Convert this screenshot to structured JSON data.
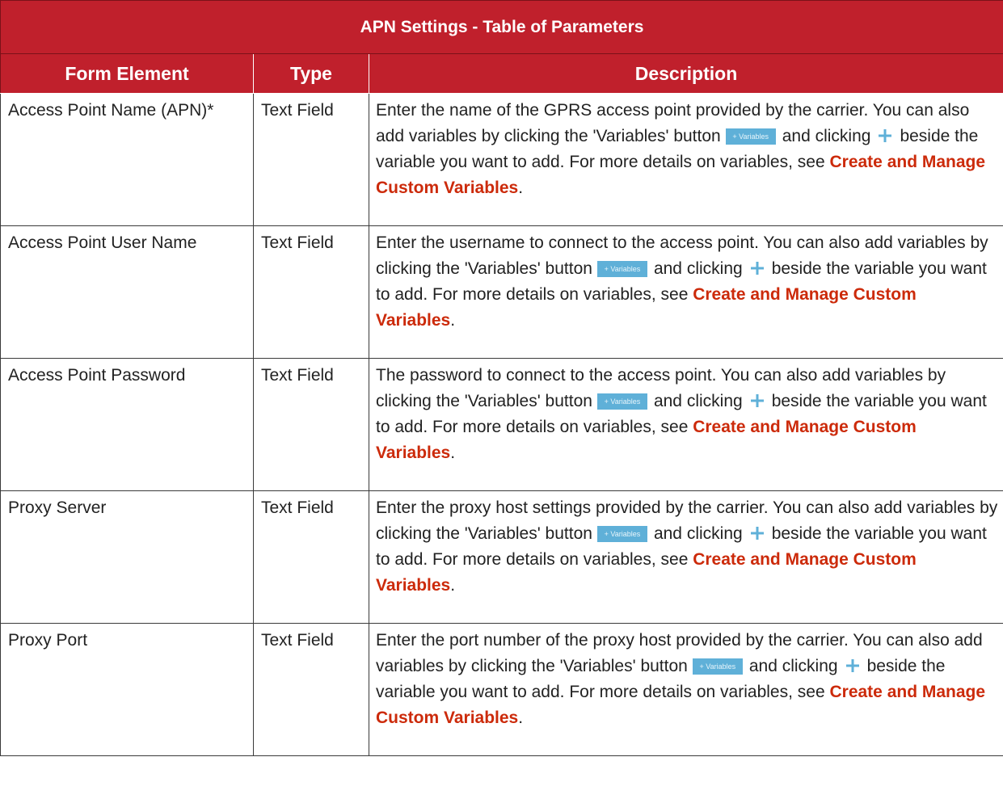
{
  "table": {
    "title": "APN Settings - Table of Parameters",
    "headers": [
      "Form Element",
      "Type",
      "Description"
    ],
    "variables_button_label": "+ Variables",
    "link_text": "Create and Manage Custom Variables",
    "rows": [
      {
        "element": "Access Point Name (APN)*",
        "type": "Text Field",
        "desc_a": "Enter the name of the GPRS access point provided by the carrier. You can also add variables by clicking the 'Variables' button",
        "desc_b": "and clicking",
        "desc_c": "beside the variable you want to add.  For more details on variables, see",
        "desc_end": "."
      },
      {
        "element": "Access Point User Name",
        "type": "Text Field",
        "desc_a": "Enter the username to connect to the access point. You can also add variables by clicking the 'Variables' button",
        "desc_b": "and clicking",
        "desc_c": "beside the variable you want to add. For more details on variables, see",
        "desc_end": "."
      },
      {
        "element": "Access Point Password",
        "type": "Text Field",
        "desc_a": "The password to connect to the access point. You can also add variables by clicking the 'Variables' button",
        "desc_b": "and clicking",
        "desc_c": "beside the variable you want to add. For more details on variables, see",
        "desc_end": "."
      },
      {
        "element": "Proxy Server",
        "type": "Text Field",
        "desc_a": "Enter the proxy host settings provided by the carrier. You can also add variables by clicking the 'Variables' button",
        "desc_b": "and clicking",
        "desc_c": "beside the variable you want to add. For more details on variables, see",
        "desc_end": "."
      },
      {
        "element": "Proxy Port",
        "type": "Text Field",
        "desc_a": "Enter the port number of the proxy host provided by the carrier. You can also add variables by clicking the 'Variables' button",
        "desc_b": "and clicking",
        "desc_c": "beside the variable you want to add. For more details on variables, see",
        "desc_end": "."
      }
    ]
  },
  "colors": {
    "header_bg": "#c0202c",
    "link": "#cc2a0a",
    "variables_button": "#5fb0d8",
    "plus_icon": "#5fb0d8"
  }
}
